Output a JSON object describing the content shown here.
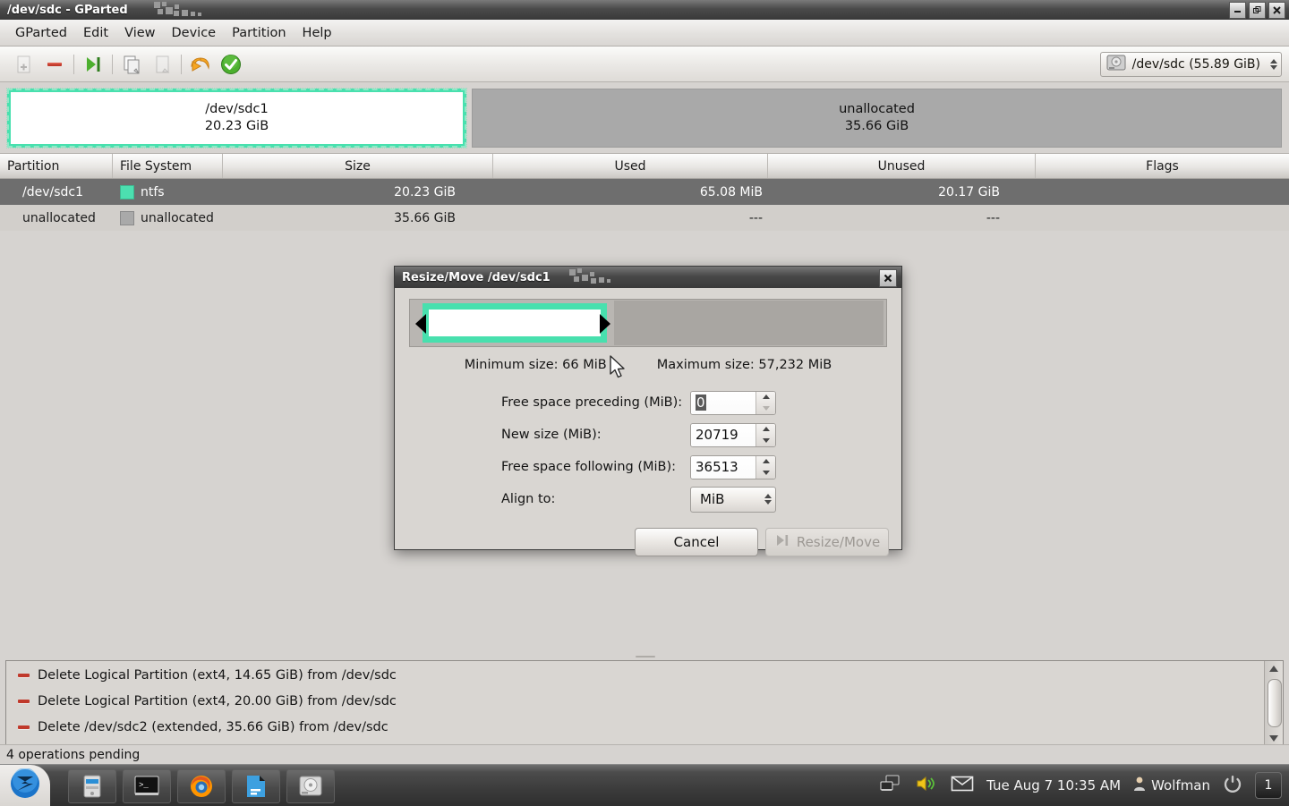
{
  "window": {
    "title": "/dev/sdc - GParted",
    "controls": [
      {
        "name": "minimize",
        "glyph": "minimize-icon"
      },
      {
        "name": "maximize",
        "glyph": "maximize-icon"
      },
      {
        "name": "close",
        "glyph": "close-icon"
      }
    ]
  },
  "menubar": {
    "items": [
      {
        "label": "GParted"
      },
      {
        "label": "Edit"
      },
      {
        "label": "View"
      },
      {
        "label": "Device"
      },
      {
        "label": "Partition"
      },
      {
        "label": "Help"
      }
    ]
  },
  "toolbar": {
    "buttons": [
      {
        "name": "new-partition-button",
        "icon": "new-document-icon",
        "enabled": false
      },
      {
        "name": "delete-partition-button",
        "icon": "minus-icon",
        "enabled": true
      },
      {
        "name": "resize-move-button",
        "icon": "resize-move-icon",
        "enabled": true
      },
      {
        "name": "copy-button",
        "icon": "copy-icon",
        "enabled": true
      },
      {
        "name": "paste-button",
        "icon": "paste-icon",
        "enabled": false
      },
      {
        "name": "undo-button",
        "icon": "undo-arrow-icon",
        "enabled": true
      },
      {
        "name": "apply-button",
        "icon": "green-check-icon",
        "enabled": true
      }
    ],
    "device_selector": {
      "icon": "hard-disk-icon",
      "label": "/dev/sdc    (55.89 GiB)"
    }
  },
  "diskview": {
    "partitions": [
      {
        "name": "/dev/sdc1",
        "size": "20.23 GiB",
        "selected": true,
        "kind": "ntfs"
      },
      {
        "name": "unallocated",
        "size": "35.66 GiB",
        "selected": false,
        "kind": "unallocated"
      }
    ]
  },
  "table": {
    "columns": [
      "Partition",
      "File System",
      "Size",
      "Used",
      "Unused",
      "Flags"
    ],
    "rows": [
      {
        "partition": "/dev/sdc1",
        "filesystem": "ntfs",
        "swatch": "#4CE0B0",
        "size": "20.23 GiB",
        "used": "65.08 MiB",
        "unused": "20.17 GiB",
        "flags": "",
        "selected": true
      },
      {
        "partition": "unallocated",
        "filesystem": "unallocated",
        "swatch": "#a9a9a9",
        "size": "35.66 GiB",
        "used": "---",
        "unused": "---",
        "flags": "",
        "selected": false
      }
    ]
  },
  "operations": {
    "items": [
      {
        "text": "Delete Logical Partition (ext4, 14.65 GiB) from /dev/sdc",
        "icon": "minus-icon"
      },
      {
        "text": "Delete Logical Partition (ext4, 20.00 GiB) from /dev/sdc",
        "icon": "minus-icon"
      },
      {
        "text": "Delete /dev/sdc2 (extended, 35.66 GiB) from /dev/sdc",
        "icon": "minus-icon"
      }
    ]
  },
  "statusbar": {
    "text": "4 operations pending"
  },
  "dialog": {
    "title": "Resize/Move /dev/sdc1",
    "close_icon": "close-icon",
    "minimum_size": "Minimum size: 66 MiB",
    "maximum_size": "Maximum size: 57,232 MiB",
    "fields": [
      {
        "label": "Free space preceding (MiB):",
        "value": "0",
        "type": "spin",
        "selected": true,
        "up_enabled": true,
        "down_enabled": false
      },
      {
        "label": "New size (MiB):",
        "value": "20719",
        "type": "spin",
        "selected": false,
        "up_enabled": true,
        "down_enabled": true
      },
      {
        "label": "Free space following (MiB):",
        "value": "36513",
        "type": "spin",
        "selected": false,
        "up_enabled": true,
        "down_enabled": true
      },
      {
        "label": "Align to:",
        "value": "MiB",
        "type": "combo"
      }
    ],
    "buttons": {
      "cancel": "Cancel",
      "resize_move": "Resize/Move",
      "resize_move_enabled": false
    }
  },
  "taskbar": {
    "start_icon": "start-menu-icon",
    "launchers": [
      {
        "name": "launcher-file-manager",
        "icon": "file-manager-icon"
      },
      {
        "name": "launcher-terminal",
        "icon": "terminal-icon"
      },
      {
        "name": "launcher-firefox",
        "icon": "firefox-icon"
      },
      {
        "name": "launcher-text-editor",
        "icon": "text-editor-icon"
      },
      {
        "name": "launcher-disk-utility",
        "icon": "hard-disk-icon"
      }
    ],
    "tray": {
      "icons": [
        "network-icon",
        "volume-icon",
        "mail-icon"
      ],
      "clock": "Tue Aug  7 10:35 AM",
      "user": "Wolfman",
      "power_icon": "power-icon",
      "workspace": "1"
    }
  },
  "colors": {
    "accent_ntfs": "#48E0AE",
    "unallocated": "#a9a9a9",
    "selection_row": "#6e6e6e"
  }
}
